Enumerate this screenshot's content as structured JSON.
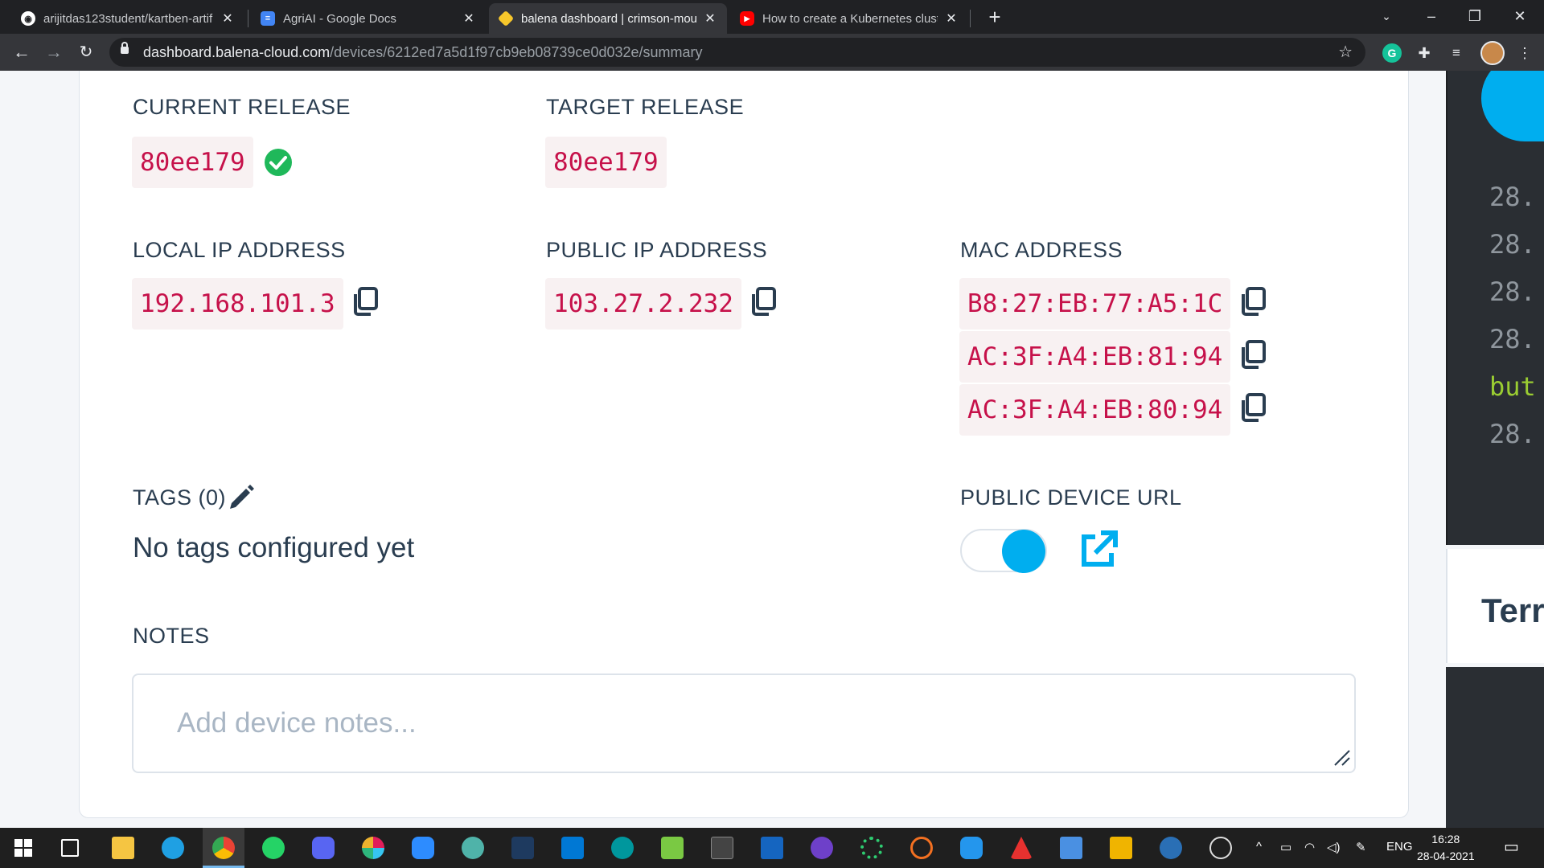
{
  "browser": {
    "tabs": [
      {
        "title": "arijitdas123student/kartben-artif",
        "icon": "github-icon"
      },
      {
        "title": "AgriAI - Google Docs",
        "icon": "google-docs-icon"
      },
      {
        "title": "balena dashboard | crimson-mou",
        "icon": "balena-cube-icon",
        "active": true
      },
      {
        "title": "How to create a Kubernetes clust",
        "icon": "youtube-icon"
      }
    ],
    "url_host": "dashboard.balena-cloud.com",
    "url_path": "/devices/6212ed7a5d1f97cb9eb08739ce0d032e/summary"
  },
  "device": {
    "current_release_label": "CURRENT RELEASE",
    "current_release": "80ee179",
    "target_release_label": "TARGET RELEASE",
    "target_release": "80ee179",
    "local_ip_label": "LOCAL IP ADDRESS",
    "local_ip": "192.168.101.3",
    "public_ip_label": "PUBLIC IP ADDRESS",
    "public_ip": "103.27.2.232",
    "mac_label": "MAC ADDRESS",
    "mac_addresses": [
      "B8:27:EB:77:A5:1C",
      "AC:3F:A4:EB:81:94",
      "AC:3F:A4:EB:80:94"
    ],
    "tags_label": "TAGS (0)",
    "no_tags_text": "No tags configured yet",
    "public_url_label": "PUBLIC DEVICE URL",
    "public_url_enabled": true,
    "notes_label": "NOTES",
    "notes_placeholder": "Add device notes...",
    "notes_value": ""
  },
  "side_panel": {
    "log_lines": [
      "28.",
      "28.",
      "28.",
      "28.",
      "but",
      "28."
    ],
    "terminal_title": "Terr"
  },
  "colors": {
    "accent": "#00aeef",
    "code_text": "#c6114a",
    "code_bg": "#f8f1f2",
    "success": "#1fb85a",
    "heading": "#2a3d50"
  },
  "taskbar": {
    "language": "ENG",
    "time": "16:28",
    "date": "28-04-2021"
  }
}
